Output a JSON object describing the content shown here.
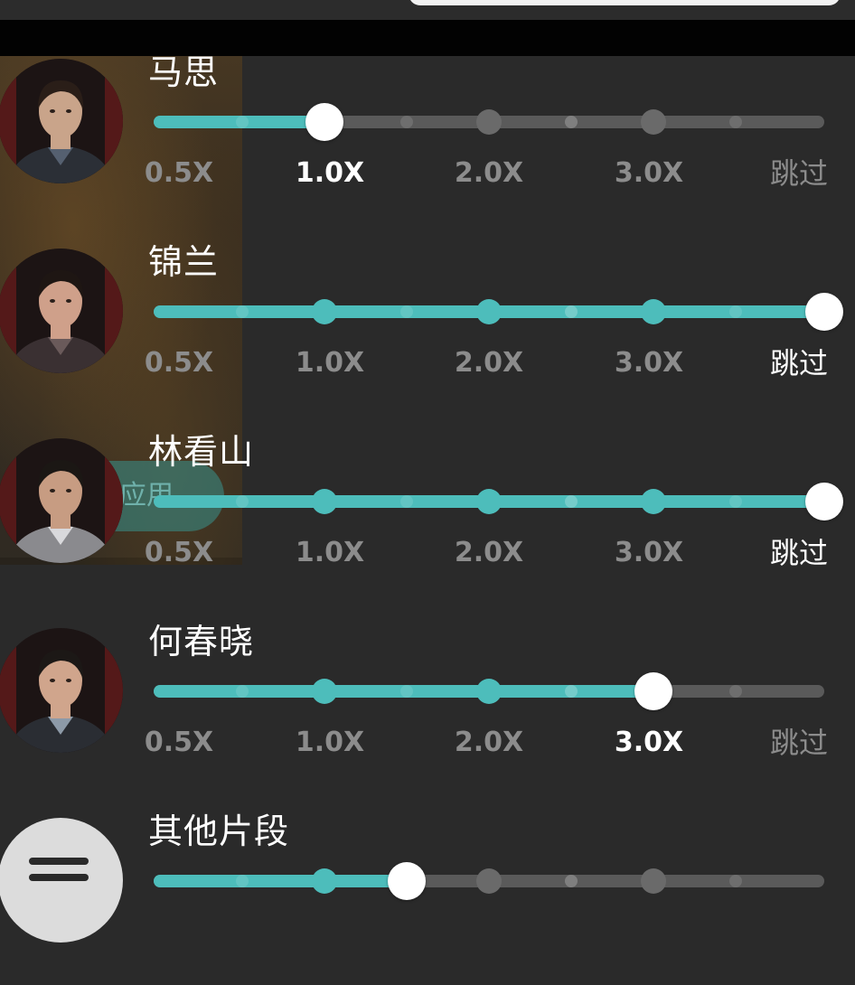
{
  "apply_button_label": "应用",
  "tick_labels": [
    "0.5X",
    "1.0X",
    "2.0X",
    "3.0X",
    "跳过"
  ],
  "colors": {
    "accent": "#4dbdbb",
    "track": "#5a5a5a",
    "panel": "#2a2a2a",
    "tick_inactive": "#8c8c8c",
    "tick_active": "#ffffff"
  },
  "icons": {
    "menu": "menu-lines-icon"
  },
  "rows": [
    {
      "name": "马思",
      "selected_index": 1,
      "selected_label": "1.0X"
    },
    {
      "name": "锦兰",
      "selected_index": 4,
      "selected_label": "跳过"
    },
    {
      "name": "林看山",
      "selected_index": 4,
      "selected_label": "跳过"
    },
    {
      "name": "何春晓",
      "selected_index": 3,
      "selected_label": "3.0X"
    },
    {
      "name": "其他片段",
      "selected_index": 1.5,
      "selected_label": ""
    }
  ]
}
